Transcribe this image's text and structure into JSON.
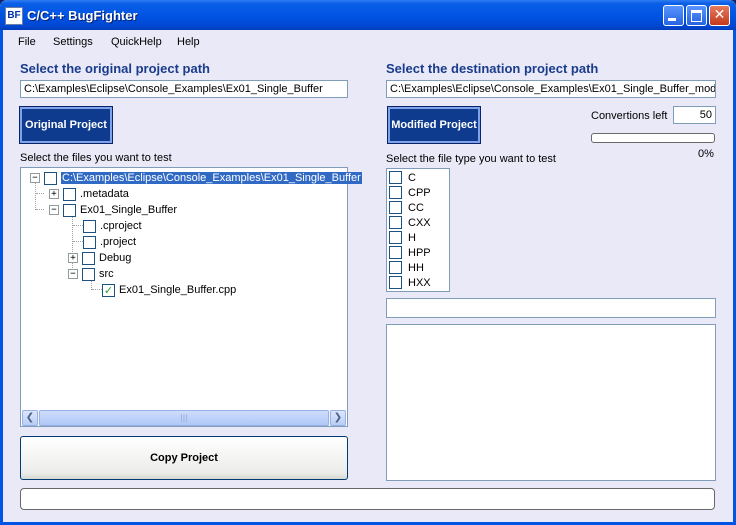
{
  "window": {
    "title": "C/C++ BugFighter",
    "icon_text": "BF",
    "minimize_icon": "minimize-icon",
    "maximize_icon": "maximize-icon",
    "close_glyph": "✕"
  },
  "menu": {
    "items": [
      {
        "label": "File"
      },
      {
        "label": "Settings"
      },
      {
        "label": "QuickHelp"
      },
      {
        "label": "Help"
      }
    ]
  },
  "left": {
    "heading": "Select the original project path",
    "path_value": "C:\\Examples\\Eclipse\\Console_Examples\\Ex01_Single_Buffer",
    "original_button": "Original Project",
    "files_label": "Select the files you want to test",
    "tree": [
      {
        "label": "C:\\Examples\\Eclipse\\Console_Examples\\Ex01_Single_Buffer",
        "expander": "−",
        "checked": false,
        "selected": true
      },
      {
        "label": ".metadata",
        "expander": "+",
        "checked": false
      },
      {
        "label": "Ex01_Single_Buffer",
        "expander": "−",
        "checked": false
      },
      {
        "label": ".cproject",
        "expander": "",
        "checked": false
      },
      {
        "label": ".project",
        "expander": "",
        "checked": false
      },
      {
        "label": "Debug",
        "expander": "+",
        "checked": false
      },
      {
        "label": "src",
        "expander": "−",
        "checked": false
      },
      {
        "label": "Ex01_Single_Buffer.cpp",
        "expander": "",
        "checked": true
      }
    ],
    "scroll_left": "❮",
    "scroll_right": "❯",
    "scroll_grip": "|||",
    "copy_button": "Copy Project"
  },
  "right": {
    "heading": "Select the destination project path",
    "path_value": "C:\\Examples\\Eclipse\\Console_Examples\\Ex01_Single_Buffer_mod",
    "modified_button": "Modified Project",
    "conversions_label": "Convertions left",
    "conversions_value": "50",
    "progress_percent": 0,
    "progress_text": "0%",
    "filetype_label": "Select the file type you want to test",
    "file_types": [
      {
        "label": "C",
        "checked": false
      },
      {
        "label": "CPP",
        "checked": false
      },
      {
        "label": "CC",
        "checked": false
      },
      {
        "label": "CXX",
        "checked": false
      },
      {
        "label": "H",
        "checked": false
      },
      {
        "label": "HPP",
        "checked": false
      },
      {
        "label": "HH",
        "checked": false
      },
      {
        "label": "HXX",
        "checked": false
      }
    ],
    "filter_value": "",
    "output_text": ""
  },
  "status": {
    "text": ""
  },
  "colors": {
    "heading": "#1a3c8c",
    "button_blue": "#0f3b8e",
    "titlebar": "#0055e5",
    "selection": "#316ac5"
  }
}
